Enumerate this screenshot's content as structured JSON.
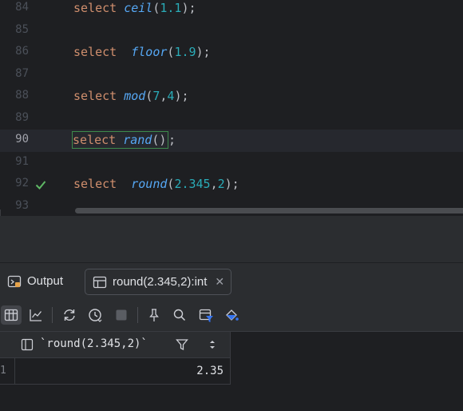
{
  "editor": {
    "lines": [
      {
        "no": "84",
        "tokens": [
          [
            "kw",
            "select "
          ],
          [
            "fn",
            "ceil"
          ],
          [
            "punc",
            "("
          ],
          [
            "num",
            "1.1"
          ],
          [
            "punc",
            ");"
          ]
        ]
      },
      {
        "no": "85",
        "tokens": []
      },
      {
        "no": "86",
        "tokens": [
          [
            "kw",
            "select  "
          ],
          [
            "fn",
            "floor"
          ],
          [
            "punc",
            "("
          ],
          [
            "num",
            "1.9"
          ],
          [
            "punc",
            ");"
          ]
        ]
      },
      {
        "no": "87",
        "tokens": []
      },
      {
        "no": "88",
        "tokens": [
          [
            "kw",
            "select "
          ],
          [
            "fn",
            "mod"
          ],
          [
            "punc",
            "("
          ],
          [
            "num",
            "7"
          ],
          [
            "punc",
            ","
          ],
          [
            "num",
            "4"
          ],
          [
            "punc",
            ");"
          ]
        ]
      },
      {
        "no": "89",
        "tokens": []
      },
      {
        "no": "90",
        "tokens": [
          [
            "kw",
            "select "
          ],
          [
            "fn",
            "rand"
          ],
          [
            "punc",
            "()"
          ]
        ],
        "trailing": ";",
        "current": true
      },
      {
        "no": "91",
        "tokens": []
      },
      {
        "no": "92",
        "tokens": [
          [
            "kw",
            "select  "
          ],
          [
            "fn",
            "round"
          ],
          [
            "punc",
            "("
          ],
          [
            "num",
            "2.345"
          ],
          [
            "punc",
            ","
          ],
          [
            "num",
            "2"
          ],
          [
            "punc",
            ");"
          ]
        ],
        "status_icon": "checkmark-icon"
      },
      {
        "no": "93",
        "tokens": []
      }
    ]
  },
  "tabs": {
    "output_label": "Output",
    "result_label": "round(2.345,2):int",
    "close_glyph": "✕"
  },
  "toolbar": {
    "icons": [
      "table-view-icon",
      "chart-view-icon",
      "refresh-icon",
      "history-icon",
      "stop-icon",
      "pin-icon",
      "search-icon",
      "filter-view-icon",
      "paint-icon"
    ]
  },
  "result_grid": {
    "column_header": "`round(2.345,2)`",
    "rows": [
      {
        "num": "1",
        "value": "2.35"
      }
    ]
  },
  "colors": {
    "keyword": "#cf8e6d",
    "function": "#56a8f5",
    "number": "#2aacb8",
    "success": "#5fb865"
  }
}
